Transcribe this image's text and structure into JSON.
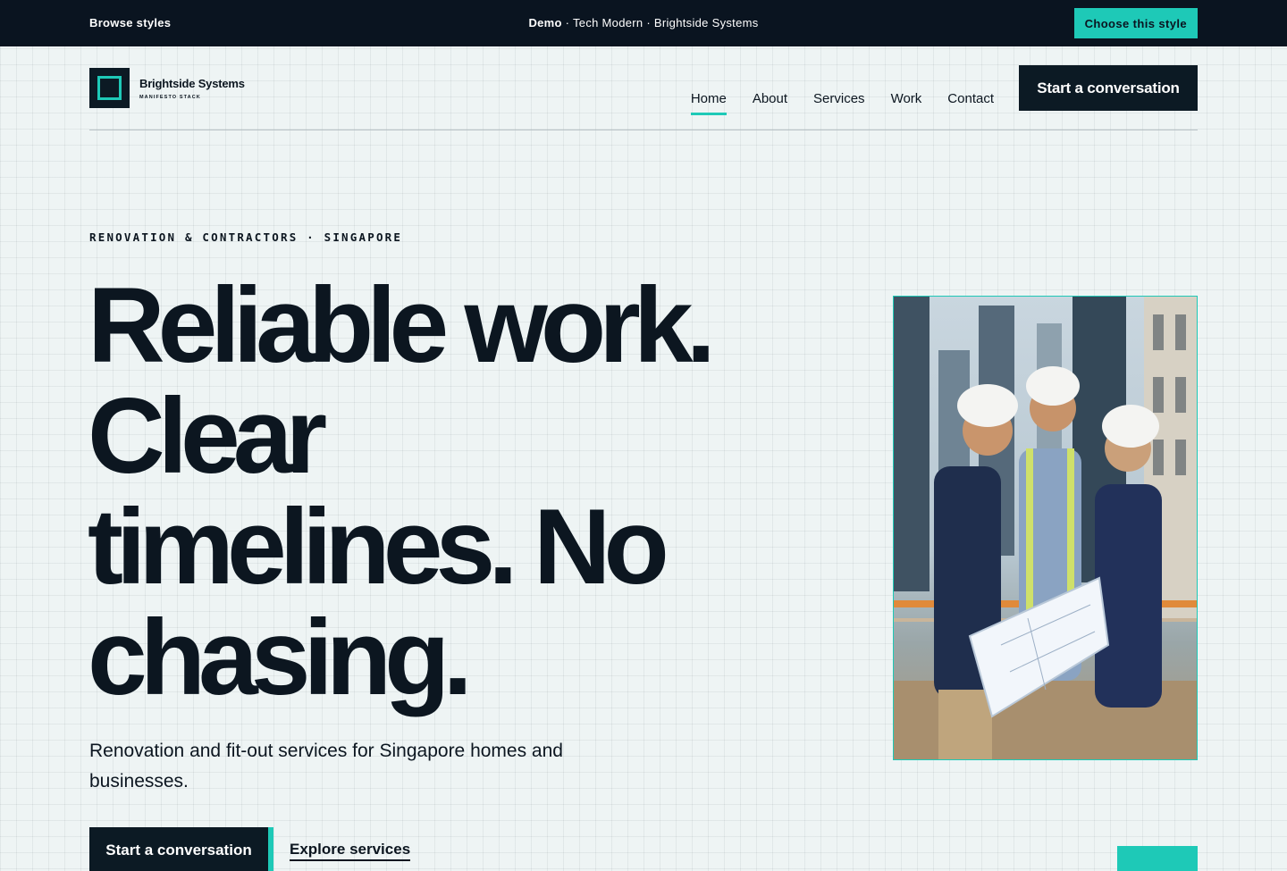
{
  "demo_bar": {
    "browse_label": "Browse styles",
    "demo_label": "Demo",
    "demo_info": " · Tech Modern · Brightside Systems",
    "choose_label": "Choose this style"
  },
  "brand": {
    "name": "Brightside Systems",
    "tagline": "MANIFESTO STACK"
  },
  "nav": {
    "items": [
      {
        "label": "Home",
        "active": true
      },
      {
        "label": "About",
        "active": false
      },
      {
        "label": "Services",
        "active": false
      },
      {
        "label": "Work",
        "active": false
      },
      {
        "label": "Contact",
        "active": false
      }
    ],
    "cta_label": "Start a conversation"
  },
  "hero": {
    "eyebrow": "RENOVATION & CONTRACTORS · SINGAPORE",
    "headline_lines": [
      "Reliable work.",
      "Clear",
      "timelines. No",
      "chasing."
    ],
    "subhead": "Renovation and fit-out services for Singapore homes and businesses.",
    "primary_cta": "Start a conversation",
    "secondary_cta": "Explore services"
  },
  "colors": {
    "accent": "#1ec9b7",
    "dark": "#0c1a24",
    "background": "#eef4f4"
  },
  "icons": {
    "logo_mark": "square-outline-icon"
  }
}
